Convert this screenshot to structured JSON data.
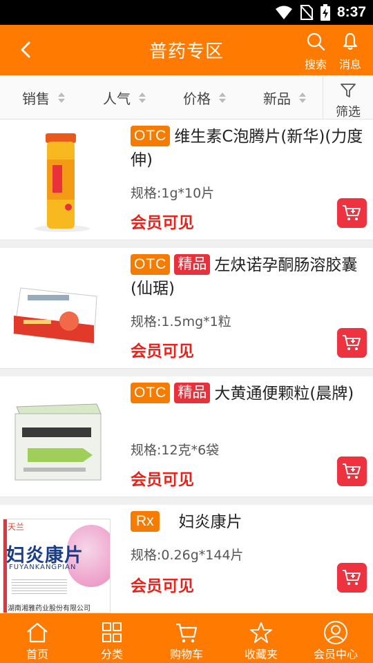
{
  "status_bar": {
    "time": "8:37"
  },
  "header": {
    "title": "普药专区",
    "search_label": "搜索",
    "message_label": "消息"
  },
  "sort_bar": {
    "items": [
      "销售",
      "人气",
      "价格",
      "新品"
    ],
    "filter_label": "筛选"
  },
  "products": [
    {
      "tags": [
        "OTC"
      ],
      "name": "维生素C泡腾片(新华)(力度伸)",
      "spec": "规格:1g*10片",
      "price_text": "会员可见",
      "image_icon": "vitamin-tube-image"
    },
    {
      "tags": [
        "OTC",
        "精品"
      ],
      "name": "左炔诺孕酮肠溶胶囊(仙琚)",
      "spec": "规格:1.5mg*1粒",
      "price_text": "会员可见",
      "image_icon": "capsule-box-image"
    },
    {
      "tags": [
        "OTC",
        "精品"
      ],
      "name": "大黄通便颗粒(晨牌)",
      "spec": "规格:12克*6袋",
      "price_text": "会员可见",
      "image_icon": "granule-box-image"
    },
    {
      "tags": [
        "Rx"
      ],
      "name": "妇炎康片",
      "spec": "规格:0.26g*144片",
      "price_text": "会员可见",
      "image_icon": "tablet-box-image",
      "image_text": {
        "brand": "天兰",
        "name": "妇炎康片",
        "pinyin": "FUYANKANGPIAN",
        "maker": "湖南湘雅药业股份有限公司"
      }
    }
  ],
  "tab_bar": {
    "items": [
      "首页",
      "分类",
      "购物车",
      "收藏夹",
      "会员中心"
    ]
  },
  "colors": {
    "brand_orange": "#ff7a00",
    "otc_tag": "#f57c00",
    "premium_tag": "#e8313b",
    "price_red": "#e8221a",
    "cart_button": "#ee3340"
  }
}
